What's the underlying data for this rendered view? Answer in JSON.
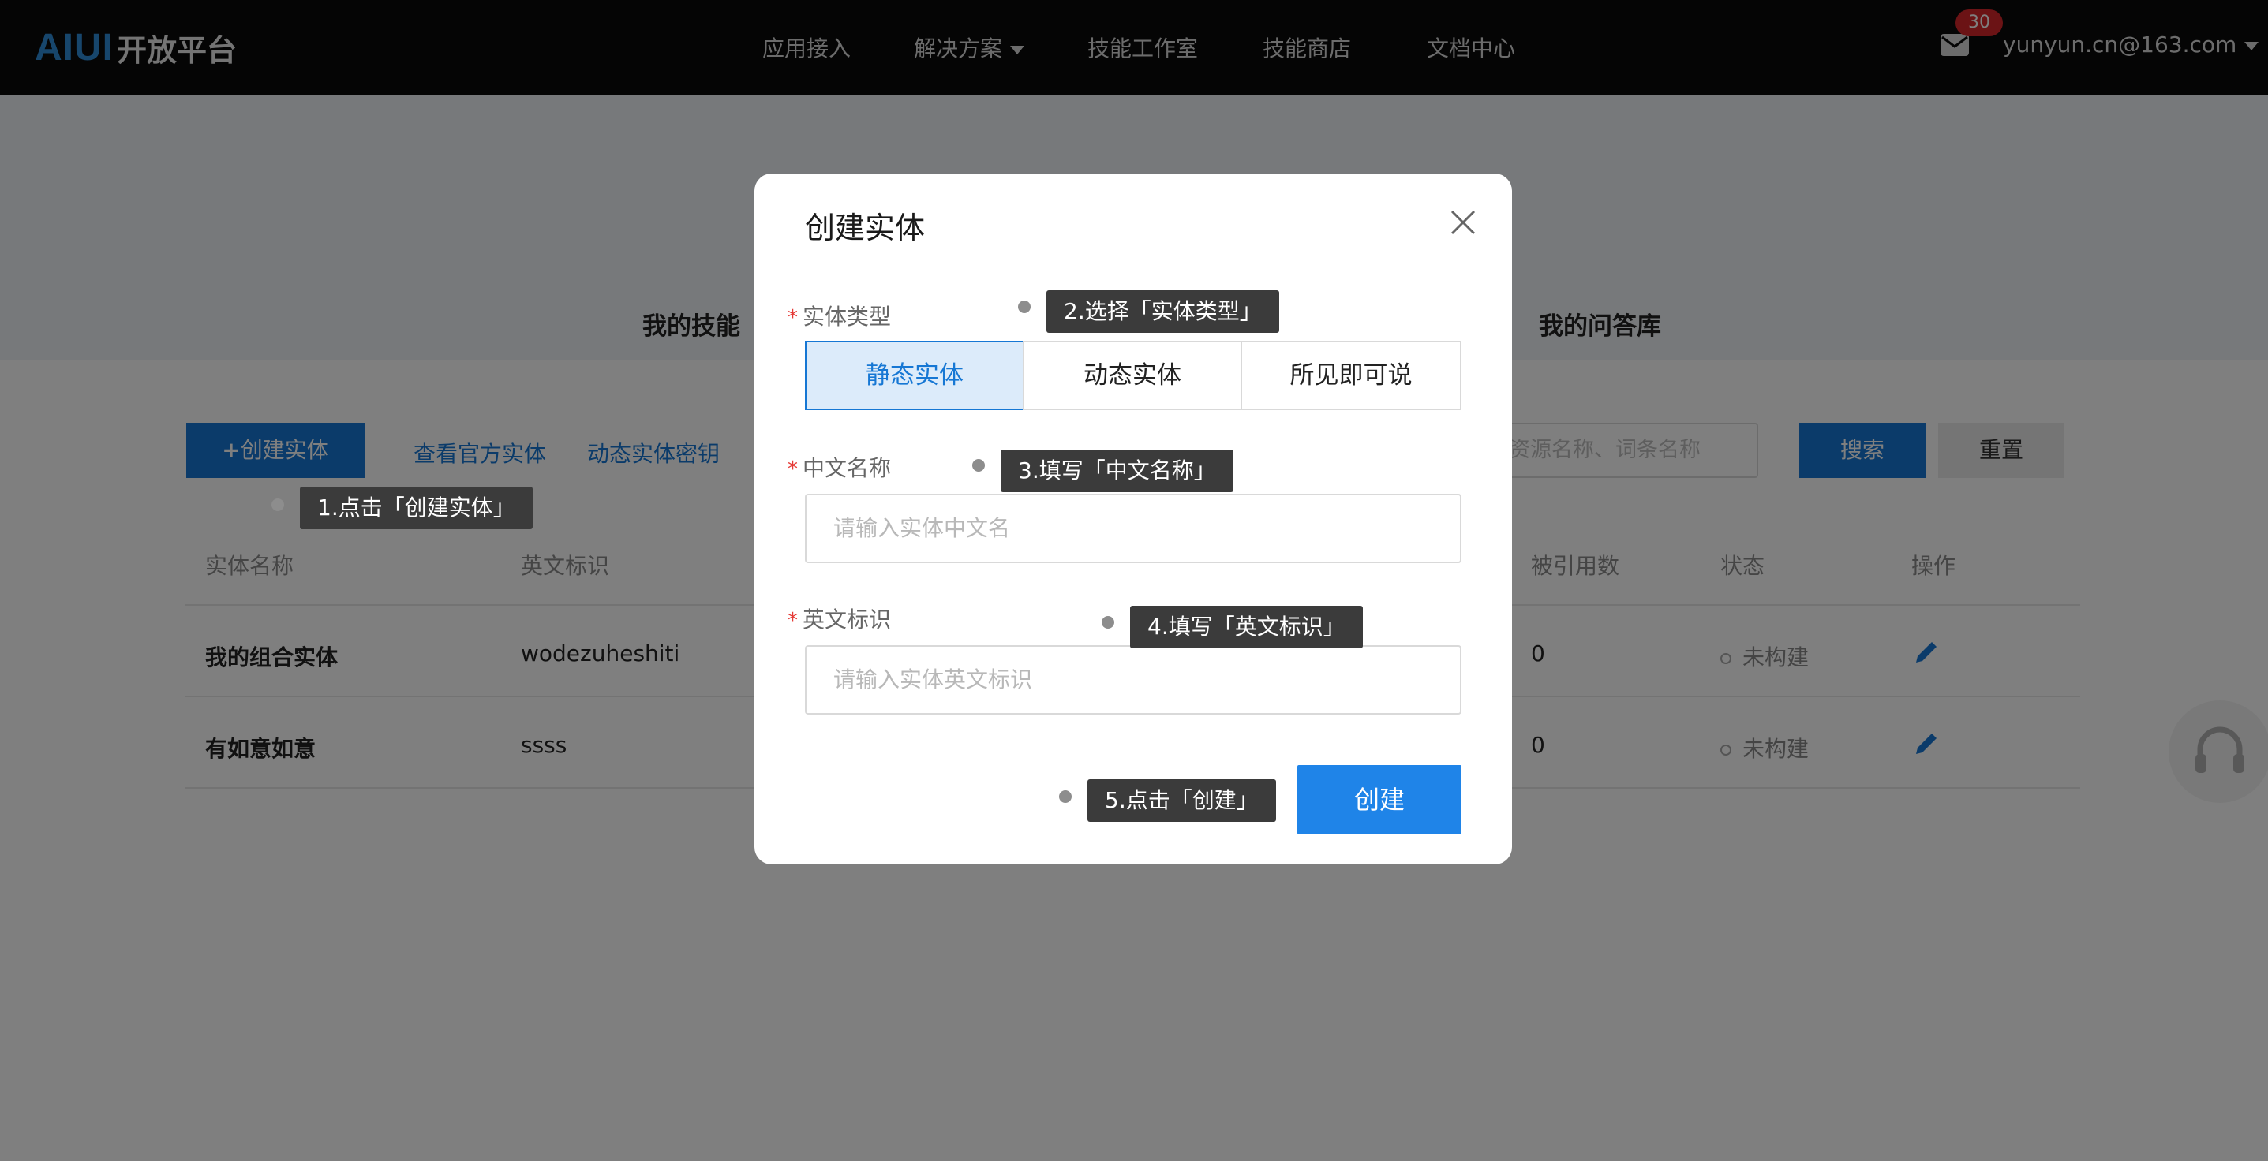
{
  "brand": {
    "mark": "AIUI",
    "name": "开放平台"
  },
  "nav": {
    "items": [
      "应用接入",
      "解决方案",
      "技能工作室",
      "技能商店",
      "文档中心"
    ],
    "mail_count": "30",
    "user": "yunyun.cn@163.com"
  },
  "tabs": {
    "left": "我的技能",
    "right": "我的问答库"
  },
  "toolbar": {
    "create_label": "创建实体",
    "official_link": "查看官方实体",
    "secret_link": "动态实体密钥",
    "search_placeholder": "资源名称、词条名称",
    "search_label": "搜索",
    "reset_label": "重置"
  },
  "table": {
    "headers": {
      "name": "实体名称",
      "en": "英文标识",
      "refs": "被引用数",
      "status": "状态",
      "ops": "操作"
    },
    "rows": [
      {
        "name": "我的组合实体",
        "en": "wodezuheshiti",
        "refs": "0",
        "status": "未构建"
      },
      {
        "name": "有如意如意",
        "en": "ssss",
        "refs": "0",
        "status": "未构建"
      }
    ]
  },
  "modal": {
    "title": "创建实体",
    "type_label": "实体类型",
    "type_options": [
      "静态实体",
      "动态实体",
      "所见即可说"
    ],
    "selected_type": "静态实体",
    "cn_label": "中文名称",
    "cn_placeholder": "请输入实体中文名",
    "en_label": "英文标识",
    "en_placeholder": "请输入实体英文标识",
    "create_label": "创建"
  },
  "tips": {
    "t1": "1.点击「创建实体」",
    "t2": "2.选择「实体类型」",
    "t3": "3.填写「中文名称」",
    "t4": "4.填写「英文标识」",
    "t5": "5.点击「创建」"
  },
  "colors": {
    "accent": "#1677d4",
    "badge": "#d6262b",
    "topbar": "#0a0a0a"
  }
}
